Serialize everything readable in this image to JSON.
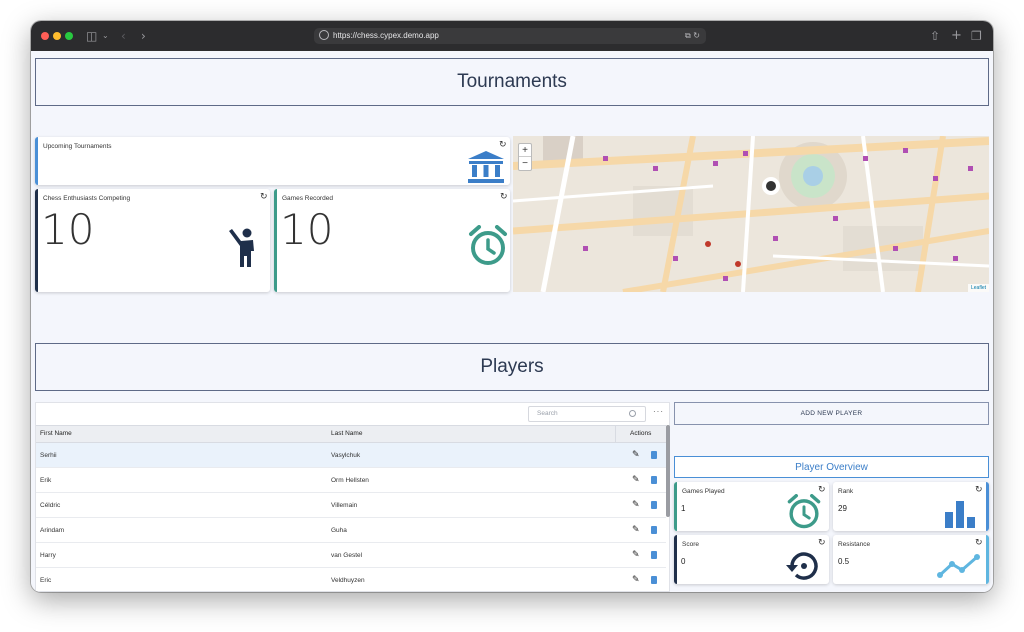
{
  "browser": {
    "url": "https://chess.cypex.demo.app",
    "traffic_colors": [
      "#ff5f57",
      "#febc2e",
      "#28c840"
    ]
  },
  "tournaments_section": {
    "title": "Tournaments",
    "cards": {
      "upcoming": {
        "title": "Upcoming Tournaments",
        "accent": "#4a8fd6",
        "icon": "bank-icon"
      },
      "enthusiasts": {
        "title": "Chess Enthusiasts Competing",
        "value": "10",
        "accent": "#1f2f4a",
        "icon": "person-waving-icon"
      },
      "games": {
        "title": "Games Recorded",
        "value": "10",
        "accent": "#3d9b8a",
        "icon": "alarm-clock-icon"
      }
    },
    "map": {
      "attribution": "Leaflet",
      "zoom_in": "+",
      "zoom_out": "−"
    }
  },
  "players_section": {
    "title": "Players",
    "search": {
      "placeholder": "Search"
    },
    "columns": {
      "first": "First Name",
      "last": "Last Name",
      "actions": "Actions"
    },
    "rows": [
      {
        "first": "Serhii",
        "last": "Vasylchuk"
      },
      {
        "first": "Erik",
        "last": "Orm Hellsten"
      },
      {
        "first": "Céldric",
        "last": "Villemain"
      },
      {
        "first": "Arindam",
        "last": "Guha"
      },
      {
        "first": "Harry",
        "last": "van Gestel"
      },
      {
        "first": "Eric",
        "last": "Veldhuyzen"
      }
    ],
    "add_button": "ADD NEW PLAYER",
    "overview_title": "Player Overview",
    "stats": {
      "games_played": {
        "title": "Games Played",
        "value": "1",
        "accent": "#3d9b8a"
      },
      "rank": {
        "title": "Rank",
        "value": "29",
        "accent": "#4a8fd6"
      },
      "score": {
        "title": "Score",
        "value": "0",
        "accent": "#1f2f4a"
      },
      "resistance": {
        "title": "Resistance",
        "value": "0.5",
        "accent": "#5fb6e0"
      }
    }
  }
}
